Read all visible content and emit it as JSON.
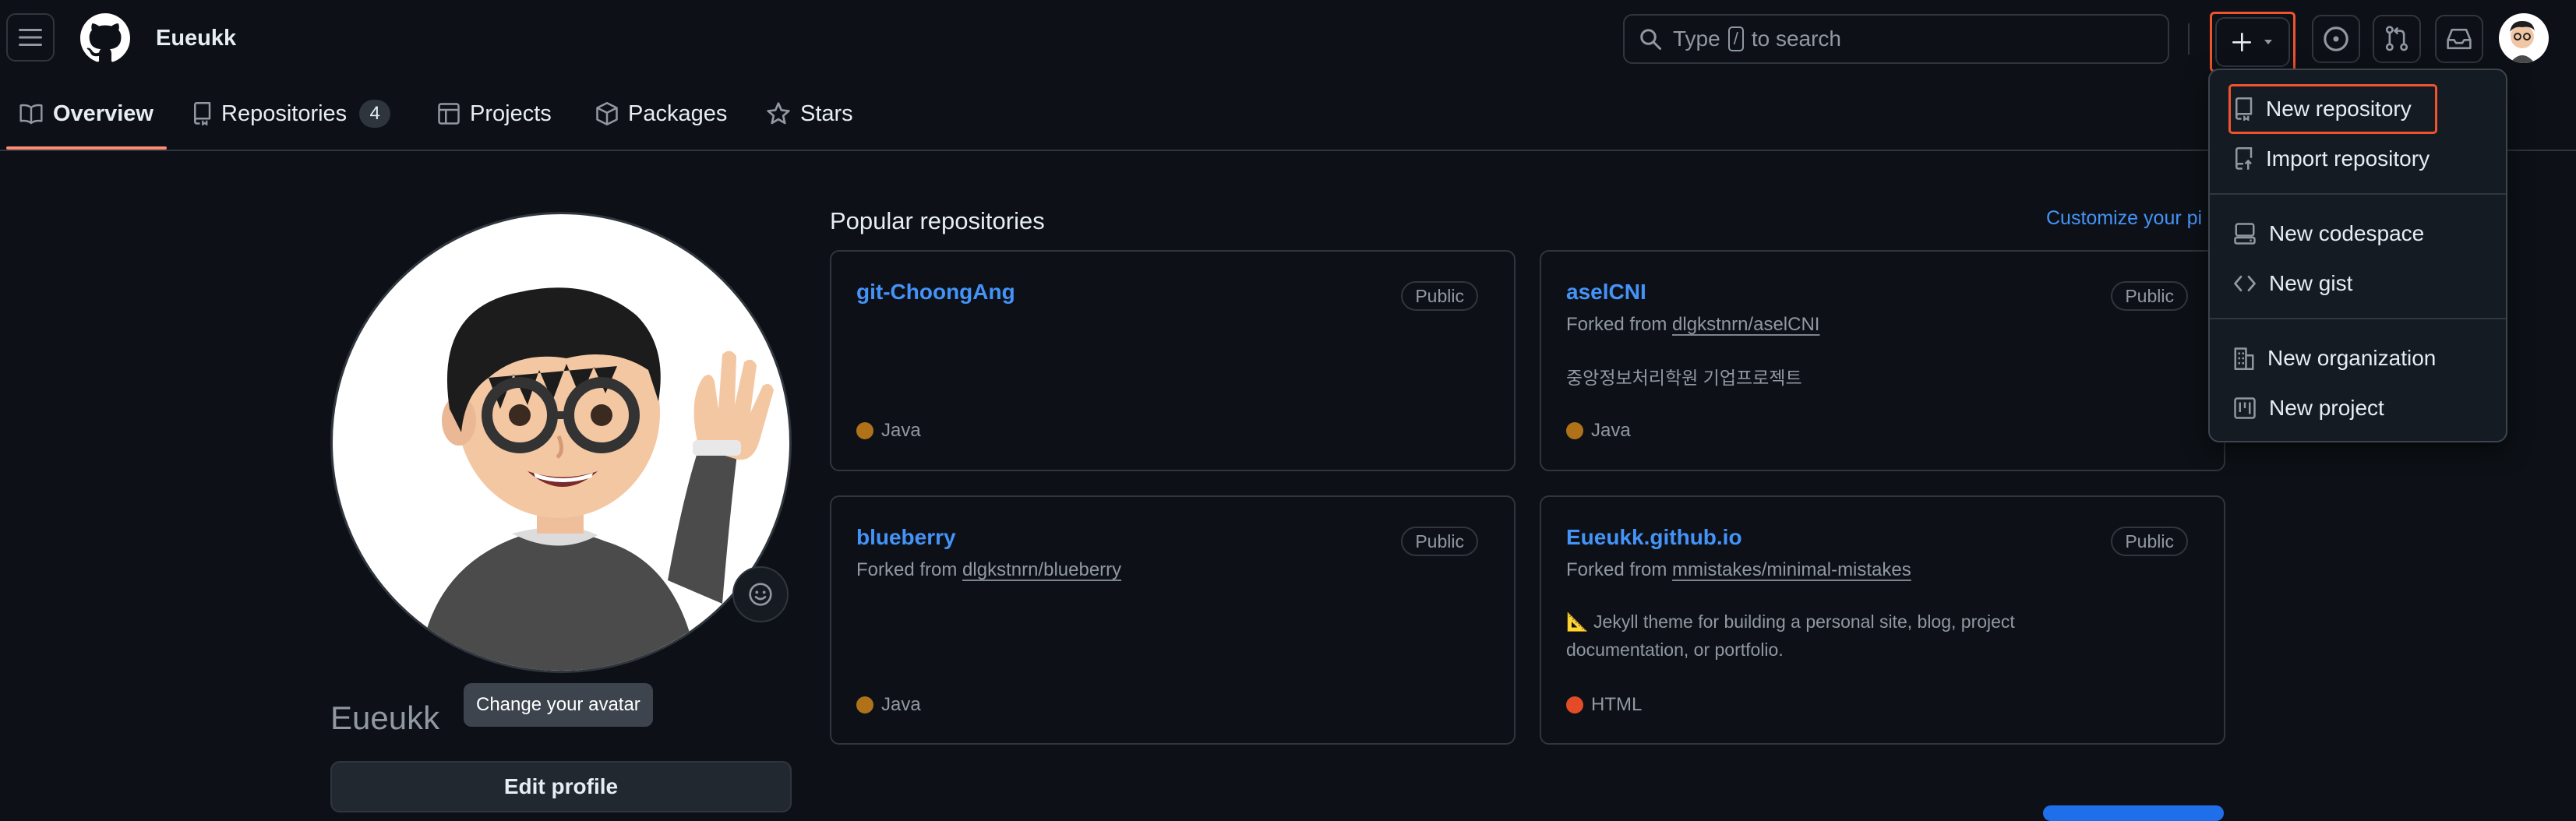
{
  "header": {
    "username": "Eueukk",
    "search_placeholder_prefix": "Type",
    "search_key": "/",
    "search_placeholder_suffix": "to search"
  },
  "tabs": [
    {
      "label": "Overview",
      "selected": true
    },
    {
      "label": "Repositories",
      "count": "4"
    },
    {
      "label": "Projects"
    },
    {
      "label": "Packages"
    },
    {
      "label": "Stars"
    }
  ],
  "profile": {
    "display_name": "Eueukk",
    "change_avatar_tooltip": "Change your avatar",
    "edit_profile_label": "Edit profile"
  },
  "popular": {
    "heading": "Popular repositories",
    "customize_label": "Customize your pi",
    "repos": [
      {
        "name": "git-ChoongAng",
        "visibility": "Public",
        "forked_prefix": "",
        "forked_from": "",
        "description": "",
        "language": "Java",
        "language_color": "#b07219"
      },
      {
        "name": "aselCNI",
        "visibility": "Public",
        "forked_prefix": "Forked from",
        "forked_from": "dlgkstnrn/aselCNI",
        "description": "중앙정보처리학원 기업프로젝트",
        "language": "Java",
        "language_color": "#b07219"
      },
      {
        "name": "blueberry",
        "visibility": "Public",
        "forked_prefix": "Forked from",
        "forked_from": "dlgkstnrn/blueberry",
        "description": "",
        "language": "Java",
        "language_color": "#b07219"
      },
      {
        "name": "Eueukk.github.io",
        "visibility": "Public",
        "forked_prefix": "Forked from",
        "forked_from": "mmistakes/minimal-mistakes",
        "description": "📐 Jekyll theme for building a personal site, blog, project documentation, or portfolio.",
        "language": "HTML",
        "language_color": "#e34c26"
      }
    ]
  },
  "create_menu": {
    "items": [
      {
        "label": "New repository",
        "icon": "repo-icon",
        "highlighted": true
      },
      {
        "label": "Import repository",
        "icon": "repo-push-icon"
      },
      {
        "label": "New codespace",
        "icon": "codespaces-icon"
      },
      {
        "label": "New gist",
        "icon": "code-icon"
      },
      {
        "label": "New organization",
        "icon": "organization-icon"
      },
      {
        "label": "New project",
        "icon": "project-icon"
      }
    ]
  },
  "colors": {
    "background": "#0d1117",
    "border": "#30363d",
    "link": "#4493f8",
    "highlight": "#f0532d",
    "tab_underline": "#fd8c73"
  }
}
